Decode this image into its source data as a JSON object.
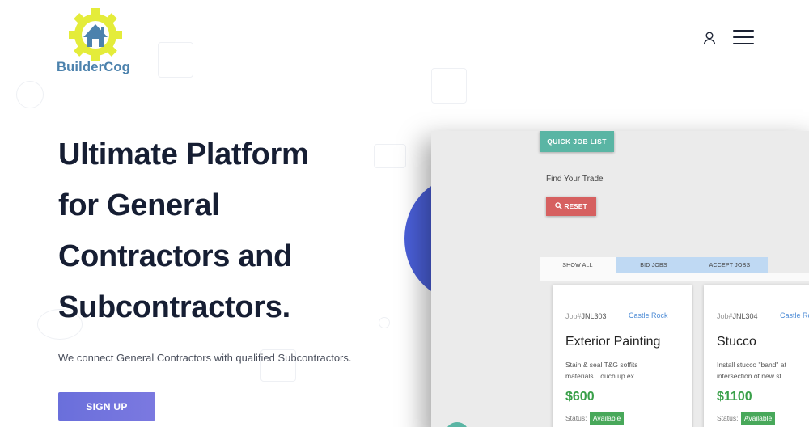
{
  "header": {
    "logo_text": "BuilderCog",
    "colors": {
      "gear": "#e4ec3a",
      "house": "#4c82ad"
    }
  },
  "hero": {
    "title_lines": [
      "Ultimate Platform",
      "for General",
      "Contractors and",
      "Subcontractors."
    ],
    "subtitle": "We connect General Contractors with qualified Subcontractors.",
    "signup_label": "SIGN UP"
  },
  "app_preview": {
    "quick_job_list_label": "QUICK JOB LIST",
    "find_trade_label": "Find Your Trade",
    "reset_label": "RESET",
    "tabs": [
      {
        "label": "SHOW ALL",
        "active": true
      },
      {
        "label": "BID JOBS",
        "active": false
      },
      {
        "label": "ACCEPT JOBS",
        "active": false
      }
    ],
    "cards": [
      {
        "job_prefix": "Job#",
        "job_number": "JNL303",
        "location": "Castle Rock",
        "title": "Exterior Painting",
        "description": "Stain & seal T&G soffits materials. Touch up ex...",
        "price": "$600",
        "status_label": "Status:",
        "status": "Available"
      },
      {
        "job_prefix": "Job#",
        "job_number": "JNL304",
        "location": "Castle Ro",
        "title": "Stucco",
        "description": "Install stucco \"band\" at intersection of new st...",
        "price": "$1100",
        "status_label": "Status:",
        "status": "Available"
      }
    ],
    "colors": {
      "quick": "#5ab5a4",
      "reset": "#d66060",
      "price": "#3aa04a",
      "badge": "#48a85a"
    }
  },
  "accent_colors": {
    "signup": "#6a6fdb",
    "blob": "#4a5fd8"
  }
}
